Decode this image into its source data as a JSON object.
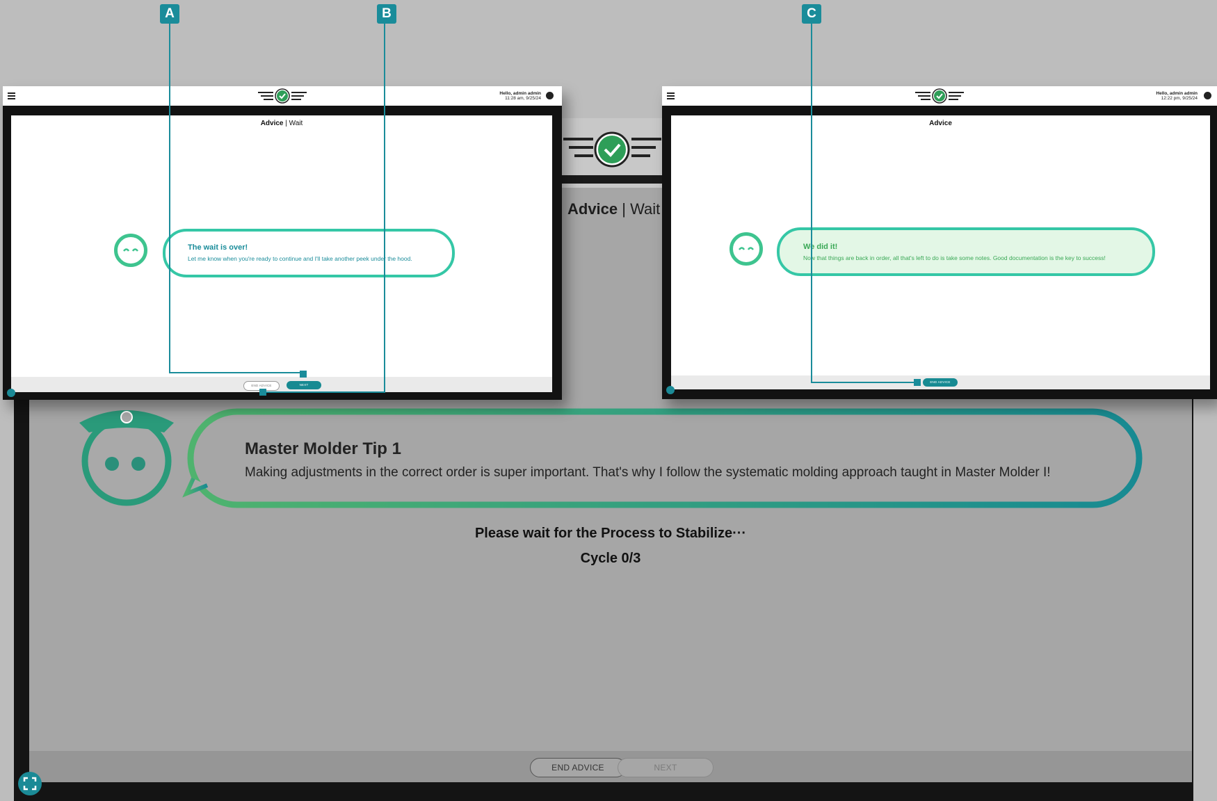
{
  "callouts": [
    "A",
    "B",
    "C"
  ],
  "background": {
    "title_bold": "Advice",
    "title_rest": " | Wait",
    "tip_title": "Master Molder Tip 1",
    "tip_text": "Making adjustments in the correct order is super important. That's why I follow the systematic molding approach taught in Master Molder I!",
    "wait_text": "Please wait for the Process to Stabilize···",
    "cycle_text": "Cycle 0/3",
    "end_button": "END ADVICE",
    "next_button": "NEXT"
  },
  "left_screen": {
    "greeting": "Hello, admin admin",
    "timestamp": "11:28 am, 9/25/24",
    "title_bold": "Advice",
    "title_rest": " | Wait",
    "bubble_title": "The wait is over!",
    "bubble_text": "Let me know when you're ready to continue and I'll take another peek under the hood.",
    "end_button": "END ADVICE",
    "next_button": "NEXT"
  },
  "right_screen": {
    "greeting": "Hello, admin admin",
    "timestamp": "12:22 pm, 9/25/24",
    "title": "Advice",
    "bubble_title": "We did it!",
    "bubble_text": "Now that things are back in order, all that's left to do is take some notes. Good documentation is the key to success!",
    "end_button": "END ADVICE"
  },
  "colors": {
    "teal": "#1a8c9a",
    "green": "#3ec48f",
    "bubble_green_fill": "#e3f7e6"
  },
  "icons": [
    "menu-icon",
    "logo-check-icon",
    "user-icon",
    "expand-icon",
    "robot-face-icon"
  ]
}
